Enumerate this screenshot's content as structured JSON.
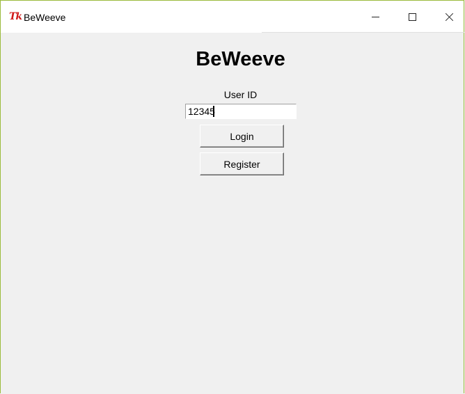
{
  "window": {
    "title": "BeWeeve",
    "icon_text": "Tk",
    "icon": "tk-feather-icon",
    "controls": {
      "minimize": "minimize-icon",
      "maximize": "maximize-icon",
      "close": "close-icon"
    },
    "border_color": "#9bbb3c"
  },
  "main": {
    "heading": "BeWeeve",
    "user_id_label": "User ID",
    "user_id_value": "12345",
    "login_label": "Login",
    "register_label": "Register"
  }
}
